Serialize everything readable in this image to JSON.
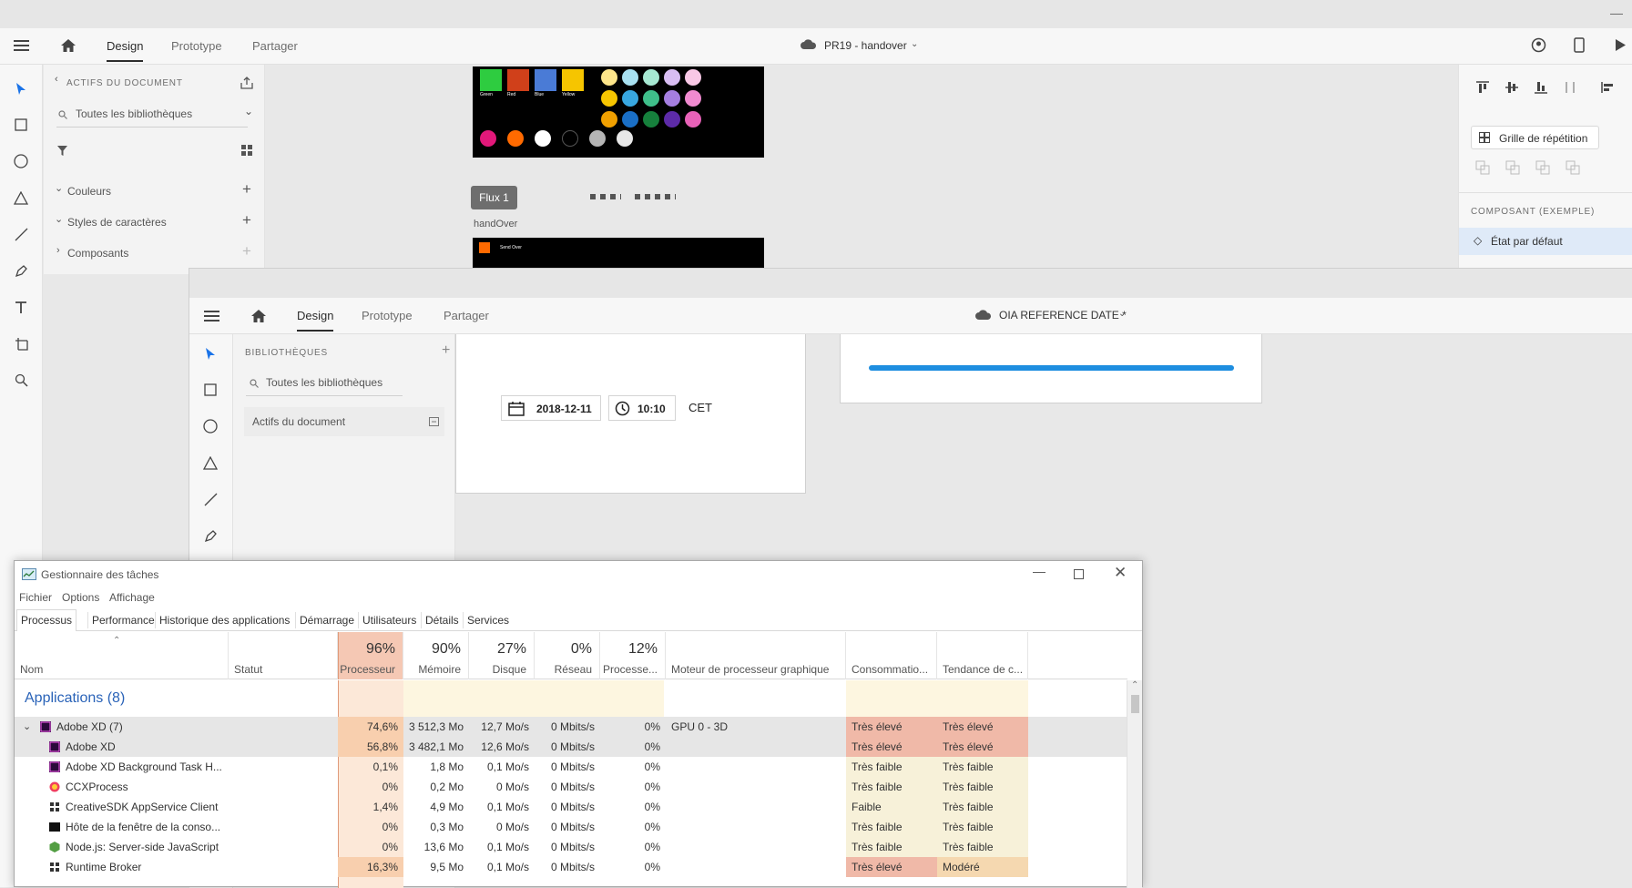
{
  "xd_back": {
    "tabs": [
      "Design",
      "Prototype",
      "Partager"
    ],
    "doc_title": "PR19 - handover",
    "panel": {
      "header": "ACTIFS DU DOCUMENT",
      "search_value": "Toutes les bibliothèques",
      "sections": [
        "Couleurs",
        "Styles de caractères",
        "Composants"
      ]
    },
    "canvas": {
      "flow_label": "Flux 1",
      "artboard_label": "handOver",
      "swatch_labels": [
        "Green",
        "Red",
        "Blue",
        "Yellow"
      ],
      "mini_nav_title": "Send Over"
    },
    "right_panel": {
      "repeat_grid": "Grille de répétition",
      "component_header": "COMPOSANT (EXEMPLE)",
      "default_state": "État par défaut"
    }
  },
  "xd_front": {
    "tabs": [
      "Design",
      "Prototype",
      "Partager"
    ],
    "doc_title": "OIA REFERENCE DATE *",
    "panel": {
      "header": "BIBLIOTHÈQUES",
      "search_value": "Toutes les bibliothèques",
      "doc_assets": "Actifs du document"
    },
    "canvas": {
      "date": "2018-12-11",
      "time": "10:10",
      "timezone": "CET"
    }
  },
  "task_manager": {
    "title": "Gestionnaire des tâches",
    "menu": [
      "Fichier",
      "Options",
      "Affichage"
    ],
    "tabs": [
      "Processus",
      "Performance",
      "Historique des applications",
      "Démarrage",
      "Utilisateurs",
      "Détails",
      "Services"
    ],
    "columns": {
      "name": "Nom",
      "status": "Statut",
      "cpu": {
        "pct": "96%",
        "label": "Processeur"
      },
      "mem": {
        "pct": "90%",
        "label": "Mémoire"
      },
      "disk": {
        "pct": "27%",
        "label": "Disque"
      },
      "net": {
        "pct": "0%",
        "label": "Réseau"
      },
      "gpu": {
        "pct": "12%",
        "label": "Processe..."
      },
      "gpu_engine": "Moteur de processeur graphique",
      "power": "Consommatio...",
      "power_trend": "Tendance de c..."
    },
    "group_label": "Applications (8)",
    "rows": [
      {
        "name": "Adobe XD (7)",
        "cpu": "74,6%",
        "mem": "3 512,3 Mo",
        "disk": "12,7 Mo/s",
        "net": "0 Mbits/s",
        "gpu": "0%",
        "engine": "GPU 0 - 3D",
        "power": "Très élevé",
        "trend": "Très élevé",
        "icon": "xd",
        "parent": true
      },
      {
        "name": "Adobe XD",
        "cpu": "56,8%",
        "mem": "3 482,1 Mo",
        "disk": "12,6 Mo/s",
        "net": "0 Mbits/s",
        "gpu": "0%",
        "engine": "",
        "power": "Très élevé",
        "trend": "Très élevé",
        "icon": "xd"
      },
      {
        "name": "Adobe XD Background Task H...",
        "cpu": "0,1%",
        "mem": "1,8 Mo",
        "disk": "0,1 Mo/s",
        "net": "0 Mbits/s",
        "gpu": "0%",
        "engine": "",
        "power": "Très faible",
        "trend": "Très faible",
        "icon": "xd"
      },
      {
        "name": "CCXProcess",
        "cpu": "0%",
        "mem": "0,2 Mo",
        "disk": "0 Mo/s",
        "net": "0 Mbits/s",
        "gpu": "0%",
        "engine": "",
        "power": "Très faible",
        "trend": "Très faible",
        "icon": "ccx"
      },
      {
        "name": "CreativeSDK AppService Client",
        "cpu": "1,4%",
        "mem": "4,9 Mo",
        "disk": "0,1 Mo/s",
        "net": "0 Mbits/s",
        "gpu": "0%",
        "engine": "",
        "power": "Faible",
        "trend": "Très faible",
        "icon": "app"
      },
      {
        "name": "Hôte de la fenêtre de la conso...",
        "cpu": "0%",
        "mem": "0,3 Mo",
        "disk": "0 Mo/s",
        "net": "0 Mbits/s",
        "gpu": "0%",
        "engine": "",
        "power": "Très faible",
        "trend": "Très faible",
        "icon": "console"
      },
      {
        "name": "Node.js: Server-side JavaScript",
        "cpu": "0%",
        "mem": "13,6 Mo",
        "disk": "0,1 Mo/s",
        "net": "0 Mbits/s",
        "gpu": "0%",
        "engine": "",
        "power": "Très faible",
        "trend": "Très faible",
        "icon": "node"
      },
      {
        "name": "Runtime Broker",
        "cpu": "16,3%",
        "mem": "9,5 Mo",
        "disk": "0,1 Mo/s",
        "net": "0 Mbits/s",
        "gpu": "0%",
        "engine": "",
        "power": "Très élevé",
        "trend": "Modéré",
        "icon": "app"
      }
    ],
    "colors": {
      "high": "#f0b9a8",
      "cpu_col": "#fbe8d4",
      "low": "#f7f1d9",
      "selected": "#d9d9d9",
      "accent": "#2a63b8"
    }
  }
}
